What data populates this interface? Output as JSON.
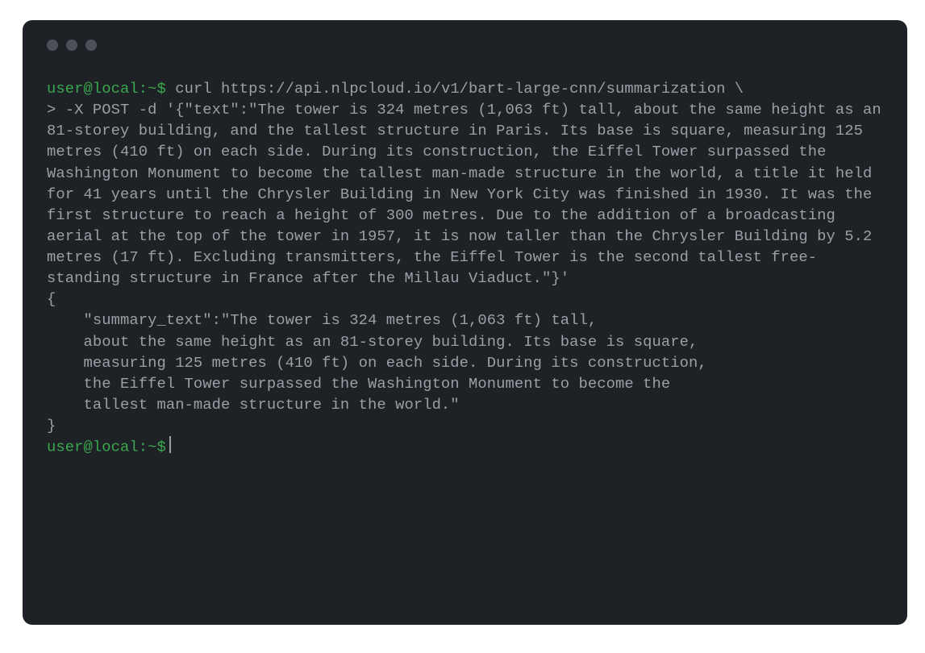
{
  "window": {
    "controls": [
      "dot",
      "dot",
      "dot"
    ]
  },
  "terminal": {
    "prompt": "user@local:~$",
    "command_line1": " curl https://api.nlpcloud.io/v1/bart-large-cnn/summarization \\",
    "command_continuation": "> -X POST -d '{\"text\":\"The tower is 324 metres (1,063 ft) tall, about the same height as an 81-storey building, and the tallest structure in Paris. Its base is square, measuring 125 metres (410 ft) on each side. During its construction, the Eiffel Tower surpassed the Washington Monument to become the tallest man-made structure in the world, a title it held for 41 years until the Chrysler Building in New York City was finished in 1930. It was the first structure to reach a height of 300 metres. Due to the addition of a broadcasting aerial at the top of the tower in 1957, it is now taller than the Chrysler Building by 5.2 metres (17 ft). Excluding transmitters, the Eiffel Tower is the second tallest free-standing structure in France after the Millau Viaduct.\"}'",
    "output": "{\n    \"summary_text\":\"The tower is 324 metres (1,063 ft) tall,\n    about the same height as an 81-storey building. Its base is square,\n    measuring 125 metres (410 ft) on each side. During its construction,\n    the Eiffel Tower surpassed the Washington Monument to become the\n    tallest man-made structure in the world.\"\n}",
    "prompt2": "user@local:~$"
  }
}
